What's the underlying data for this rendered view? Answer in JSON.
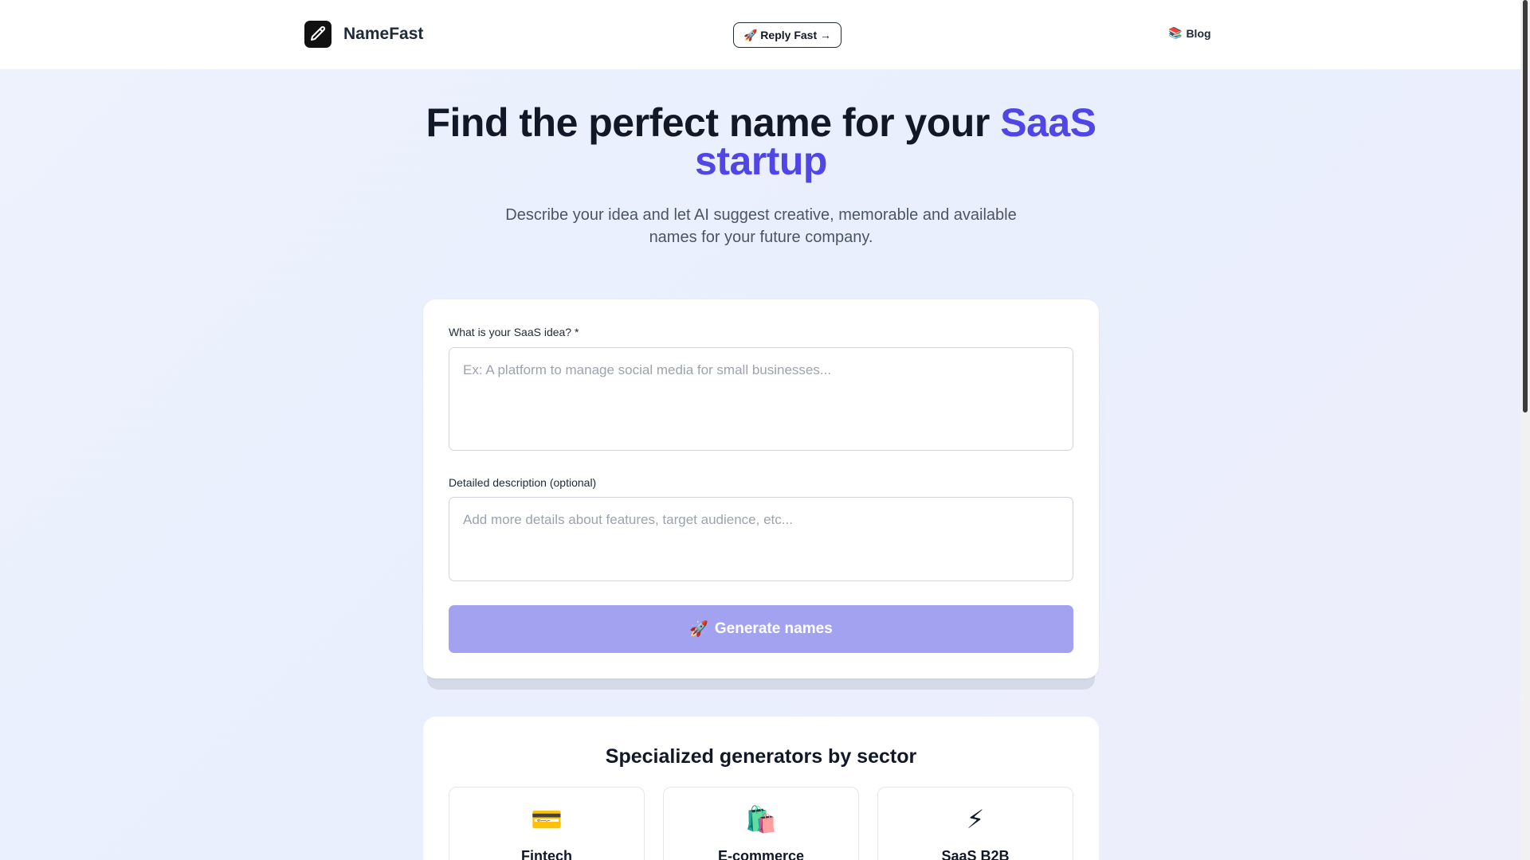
{
  "header": {
    "brand": "NameFast",
    "reply_button": "🚀 Reply Fast →",
    "blog_icon": "📚",
    "blog_label": "Blog"
  },
  "hero": {
    "title_main": "Find the perfect name for your",
    "title_accent": "SaaS startup",
    "subtitle": "Describe your idea and let AI suggest creative, memorable and available names for your future company."
  },
  "form": {
    "idea_label": "What is your SaaS idea? *",
    "idea_placeholder": "Ex: A platform to manage social media for small businesses...",
    "description_label": "Detailed description (optional)",
    "description_placeholder": "Add more details about features, target audience, etc...",
    "generate_icon": "🚀",
    "generate_label": "Generate names"
  },
  "sectors": {
    "title": "Specialized generators by sector",
    "items": [
      {
        "emoji": "💳",
        "name": "Fintech"
      },
      {
        "emoji": "🛍️",
        "name": "E-commerce"
      },
      {
        "emoji": "⚡",
        "name": "SaaS B2B"
      }
    ]
  },
  "colors": {
    "accent": "#5046e5",
    "button_disabled": "#a3a2f0",
    "text_primary": "#111827",
    "text_secondary": "#4b5563"
  },
  "icons": {
    "logo": "pencil-icon",
    "blog": "books-icon",
    "generate": "rocket-icon"
  }
}
